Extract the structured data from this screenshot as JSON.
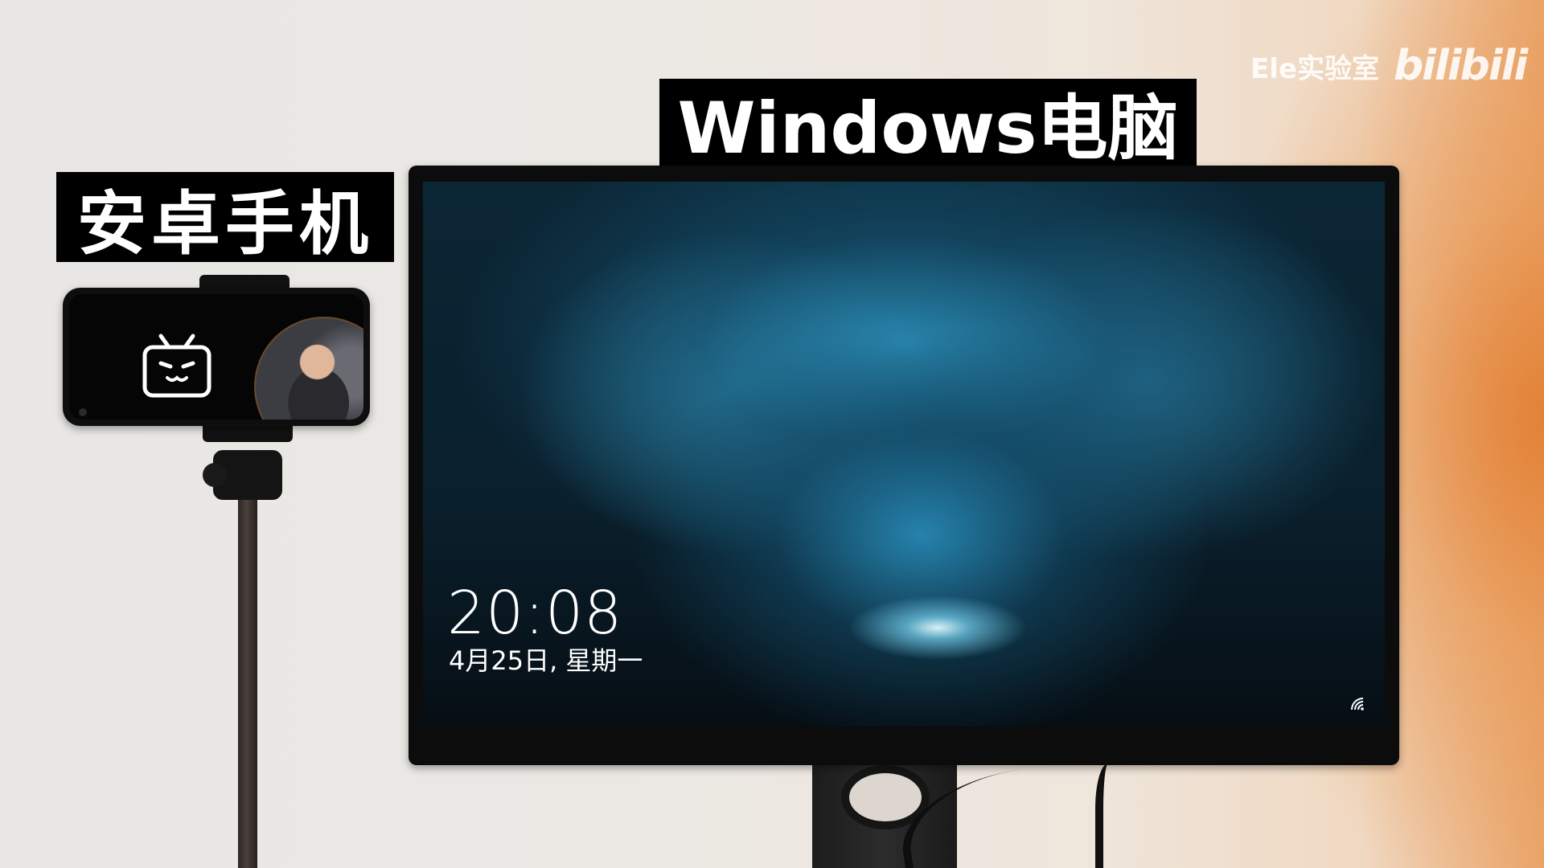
{
  "labels": {
    "phone": "安卓手机",
    "pc": "Windows电脑"
  },
  "watermark": {
    "channel": "Ele实验室",
    "logo": "bilibili"
  },
  "lock_screen": {
    "time": "20:08",
    "date": "4月25日, 星期一"
  },
  "icons": {
    "phone_app": "bilibili-tv-icon",
    "network": "wifi-icon"
  },
  "colors": {
    "label_bg": "#000000",
    "label_text": "#ffffff",
    "wallpaper_blue": "#2a8fbf"
  }
}
